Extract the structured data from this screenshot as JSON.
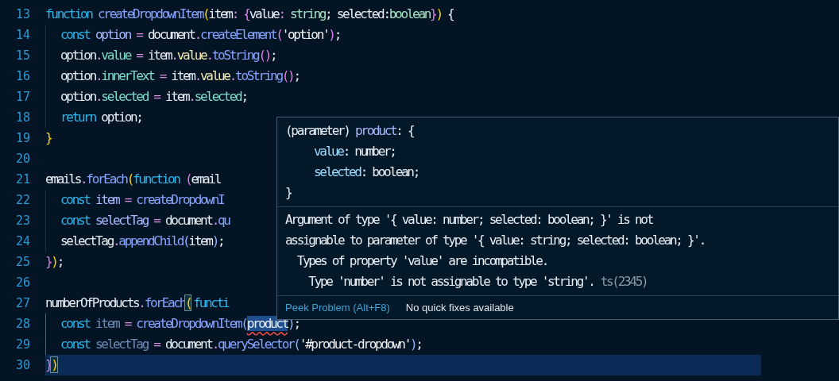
{
  "editor": {
    "lines": [
      {
        "number": "13",
        "indent": false,
        "current": false,
        "tokens": [
          {
            "kind": "kw",
            "s": "function "
          },
          {
            "kind": "fn",
            "s": "createDropdownItem"
          },
          {
            "kind": "b1",
            "s": "("
          },
          {
            "kind": "plain",
            "s": "item"
          },
          {
            "kind": "punct",
            "s": ": "
          },
          {
            "kind": "b2",
            "s": "{"
          },
          {
            "kind": "plain",
            "s": "value"
          },
          {
            "kind": "punct",
            "s": ": "
          },
          {
            "kind": "type",
            "s": "string"
          },
          {
            "kind": "plain",
            "s": "; selected:"
          },
          {
            "kind": "type",
            "s": "boolean"
          },
          {
            "kind": "b2",
            "s": "}"
          },
          {
            "kind": "b1",
            "s": ")"
          },
          {
            "kind": "plain",
            "s": " {"
          }
        ]
      },
      {
        "number": "14",
        "indent": true,
        "current": false,
        "tokens": [
          {
            "kind": "kw",
            "s": "const "
          },
          {
            "kind": "var",
            "s": "option"
          },
          {
            "kind": "punct",
            "s": " = "
          },
          {
            "kind": "plain",
            "s": "document"
          },
          {
            "kind": "punct",
            "s": "."
          },
          {
            "kind": "fn",
            "s": "createElement"
          },
          {
            "kind": "b2",
            "s": "("
          },
          {
            "kind": "str",
            "s": "'option'"
          },
          {
            "kind": "b2",
            "s": ")"
          },
          {
            "kind": "plain",
            "s": ";"
          }
        ]
      },
      {
        "number": "15",
        "indent": true,
        "current": false,
        "tokens": [
          {
            "kind": "plain",
            "s": "option"
          },
          {
            "kind": "punct",
            "s": "."
          },
          {
            "kind": "prop",
            "s": "value"
          },
          {
            "kind": "punct",
            "s": " = "
          },
          {
            "kind": "plain",
            "s": "item"
          },
          {
            "kind": "punct",
            "s": "."
          },
          {
            "kind": "field",
            "s": "value"
          },
          {
            "kind": "punct",
            "s": "."
          },
          {
            "kind": "fn",
            "s": "toString"
          },
          {
            "kind": "b2",
            "s": "()"
          },
          {
            "kind": "plain",
            "s": ";"
          }
        ]
      },
      {
        "number": "16",
        "indent": true,
        "current": false,
        "tokens": [
          {
            "kind": "plain",
            "s": "option"
          },
          {
            "kind": "punct",
            "s": "."
          },
          {
            "kind": "prop",
            "s": "innerText"
          },
          {
            "kind": "punct",
            "s": " = "
          },
          {
            "kind": "plain",
            "s": "item"
          },
          {
            "kind": "punct",
            "s": "."
          },
          {
            "kind": "field",
            "s": "value"
          },
          {
            "kind": "punct",
            "s": "."
          },
          {
            "kind": "fn",
            "s": "toString"
          },
          {
            "kind": "b2",
            "s": "()"
          },
          {
            "kind": "plain",
            "s": ";"
          }
        ]
      },
      {
        "number": "17",
        "indent": true,
        "current": false,
        "tokens": [
          {
            "kind": "plain",
            "s": "option"
          },
          {
            "kind": "punct",
            "s": "."
          },
          {
            "kind": "prop",
            "s": "selected"
          },
          {
            "kind": "punct",
            "s": " = "
          },
          {
            "kind": "plain",
            "s": "item"
          },
          {
            "kind": "punct",
            "s": "."
          },
          {
            "kind": "prop",
            "s": "selected"
          },
          {
            "kind": "plain",
            "s": ";"
          }
        ]
      },
      {
        "number": "18",
        "indent": true,
        "current": false,
        "tokens": [
          {
            "kind": "kw",
            "s": "return "
          },
          {
            "kind": "plain",
            "s": "option;"
          }
        ]
      },
      {
        "number": "19",
        "indent": false,
        "current": false,
        "tokens": [
          {
            "kind": "b1",
            "s": "}"
          }
        ]
      },
      {
        "number": "20",
        "indent": false,
        "current": false
      },
      {
        "number": "21",
        "indent": false,
        "current": false,
        "tokens": [
          {
            "kind": "plain",
            "s": "emails"
          },
          {
            "kind": "punct",
            "s": "."
          },
          {
            "kind": "fn",
            "s": "forEach"
          },
          {
            "kind": "b1",
            "s": "("
          },
          {
            "kind": "kw",
            "s": "function "
          },
          {
            "kind": "b2",
            "s": "("
          },
          {
            "kind": "plain",
            "s": "email"
          }
        ]
      },
      {
        "number": "22",
        "indent": true,
        "current": false,
        "tokens": [
          {
            "kind": "kw",
            "s": "const "
          },
          {
            "kind": "var",
            "s": "item"
          },
          {
            "kind": "punct",
            "s": " = "
          },
          {
            "kind": "fn",
            "s": "createDropdownI"
          }
        ]
      },
      {
        "number": "23",
        "indent": true,
        "current": false,
        "tokens": [
          {
            "kind": "kw",
            "s": "const "
          },
          {
            "kind": "var",
            "s": "selectTag"
          },
          {
            "kind": "punct",
            "s": " = "
          },
          {
            "kind": "plain",
            "s": "document"
          },
          {
            "kind": "punct",
            "s": "."
          },
          {
            "kind": "fn",
            "s": "qu"
          }
        ]
      },
      {
        "number": "24",
        "indent": true,
        "current": false,
        "tokens": [
          {
            "kind": "plain",
            "s": "selectTag"
          },
          {
            "kind": "punct",
            "s": "."
          },
          {
            "kind": "fn",
            "s": "appendChild"
          },
          {
            "kind": "b3",
            "s": "("
          },
          {
            "kind": "plain",
            "s": "item"
          },
          {
            "kind": "b3",
            "s": ")"
          },
          {
            "kind": "plain",
            "s": ";"
          }
        ]
      },
      {
        "number": "25",
        "indent": false,
        "current": false,
        "tokens": [
          {
            "kind": "b2",
            "s": "}"
          },
          {
            "kind": "b1",
            "s": ")"
          },
          {
            "kind": "plain",
            "s": ";"
          }
        ]
      },
      {
        "number": "26",
        "indent": false,
        "current": false
      },
      {
        "number": "27",
        "indent": false,
        "current": false,
        "tokens": [
          {
            "kind": "plain",
            "s": "numberOfProducts"
          },
          {
            "kind": "punct",
            "s": "."
          },
          {
            "kind": "fn",
            "s": "forEach"
          },
          {
            "kind": "match",
            "s": "("
          },
          {
            "kind": "kw",
            "s": "functi"
          }
        ]
      },
      {
        "number": "28",
        "indent": true,
        "current": false,
        "tokens": [
          {
            "kind": "kw",
            "s": "const "
          },
          {
            "kind": "dim",
            "s": "item"
          },
          {
            "kind": "punct",
            "s": " = "
          },
          {
            "kind": "fn",
            "s": "createDropdownItem"
          },
          {
            "kind": "b3",
            "s": "("
          },
          {
            "kind": "error",
            "s": "product"
          },
          {
            "kind": "b3",
            "s": ")"
          },
          {
            "kind": "plain",
            "s": ";"
          }
        ]
      },
      {
        "number": "29",
        "indent": true,
        "current": false,
        "tokens": [
          {
            "kind": "kw",
            "s": "const "
          },
          {
            "kind": "dim",
            "s": "selectTag"
          },
          {
            "kind": "punct",
            "s": " = "
          },
          {
            "kind": "plain",
            "s": "document"
          },
          {
            "kind": "punct",
            "s": "."
          },
          {
            "kind": "fn",
            "s": "querySelector"
          },
          {
            "kind": "b3",
            "s": "("
          },
          {
            "kind": "str",
            "s": "'#product-dropdown'"
          },
          {
            "kind": "b3",
            "s": ")"
          },
          {
            "kind": "plain",
            "s": ";"
          }
        ]
      },
      {
        "number": "30",
        "indent": false,
        "current": true,
        "tokens": [
          {
            "kind": "b2",
            "s": "}"
          },
          {
            "kind": "match",
            "s": ")"
          }
        ]
      }
    ]
  },
  "hover": {
    "signature": [
      {
        "indent": false,
        "tokens": [
          {
            "kind": "plain",
            "s": "(parameter) "
          },
          {
            "kind": "var",
            "s": "product"
          },
          {
            "kind": "plain",
            "s": ": {"
          }
        ]
      },
      {
        "indent": true,
        "tokens": [
          {
            "kind": "sig",
            "s": "value"
          },
          {
            "kind": "plain",
            "s": ": number;"
          }
        ]
      },
      {
        "indent": true,
        "tokens": [
          {
            "kind": "sig",
            "s": "selected"
          },
          {
            "kind": "plain",
            "s": ": boolean;"
          }
        ]
      },
      {
        "indent": false,
        "tokens": [
          {
            "kind": "plain",
            "s": "}"
          }
        ]
      }
    ],
    "message": [
      "Argument of type '{ value: number; selected: boolean; }' is not",
      "assignable to parameter of type '{ value: string; selected: boolean; }'.",
      "  Types of property 'value' are incompatible.",
      "    Type 'number' is not assignable to type 'string'."
    ],
    "code": "ts(2345)",
    "actions": [
      {
        "kind": "link",
        "label": "Peek Problem (Alt+F8)"
      },
      {
        "kind": "note",
        "label": "No quick fixes available"
      }
    ]
  }
}
